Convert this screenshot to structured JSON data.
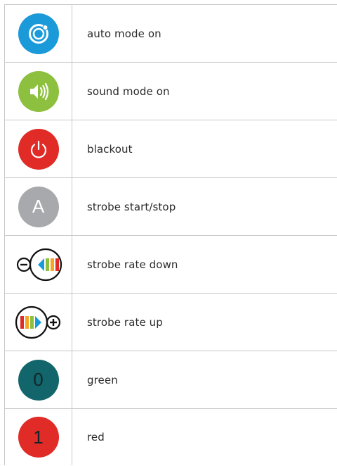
{
  "rows": [
    {
      "label": "auto mode on",
      "icon": "auto-mode-icon",
      "color": "#1a9ad9"
    },
    {
      "label": "sound mode on",
      "icon": "speaker-icon",
      "color": "#8cc03e"
    },
    {
      "label": "blackout",
      "icon": "power-icon",
      "color": "#e02b27"
    },
    {
      "label": "strobe start/stop",
      "icon": "letter-a-icon",
      "color": "#a7a9ac",
      "glyph": "A"
    },
    {
      "label": "strobe rate down",
      "icon": "strobe-rate-down-icon"
    },
    {
      "label": "strobe rate up",
      "icon": "strobe-rate-up-icon"
    },
    {
      "label": "green",
      "icon": "digit-0-icon",
      "color": "#12666b",
      "glyph": "0"
    },
    {
      "label": "red",
      "icon": "digit-1-icon",
      "color": "#e02b27",
      "glyph": "1"
    }
  ]
}
